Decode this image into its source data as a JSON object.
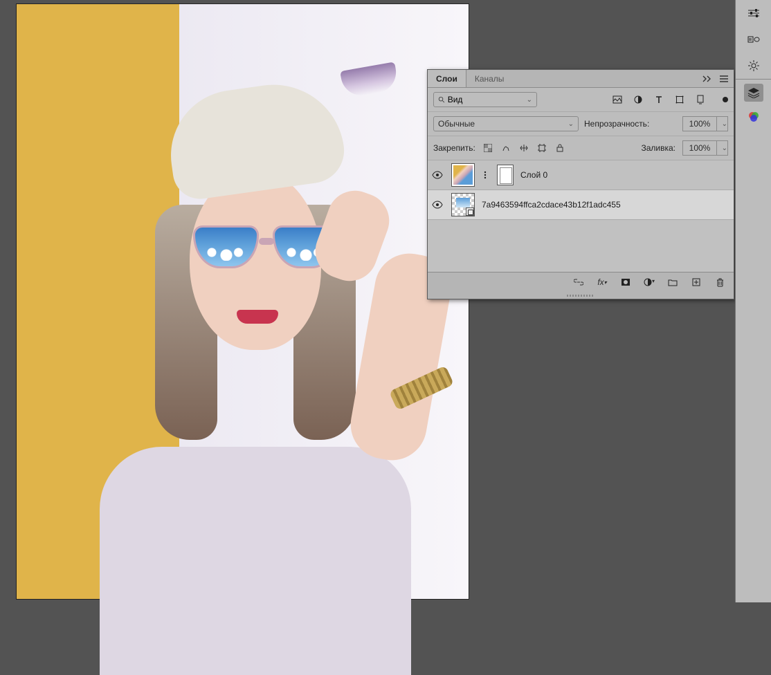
{
  "panel": {
    "tabs": {
      "layers": "Слои",
      "channels": "Каналы"
    },
    "search_placeholder": "Вид",
    "blend_mode": "Обычные",
    "opacity_label": "Непрозрачность:",
    "opacity_value": "100%",
    "lock_label": "Закрепить:",
    "fill_label": "Заливка:",
    "fill_value": "100%",
    "layers": [
      {
        "name": "Слой 0"
      },
      {
        "name": "7a9463594ffca2cdace43b12f1adc455"
      }
    ]
  },
  "icons": {
    "expand": "»",
    "menu": "≡",
    "search": "search-icon",
    "chevron": "⌄"
  }
}
